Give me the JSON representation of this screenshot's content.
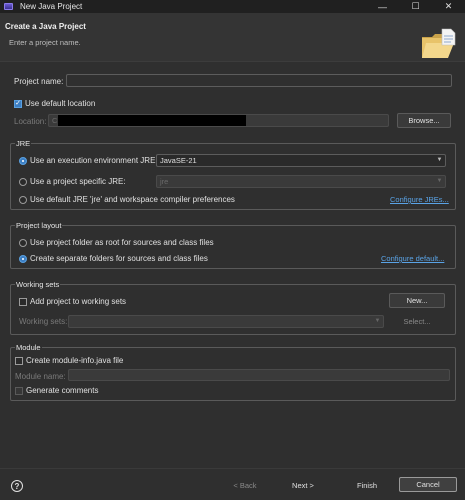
{
  "window": {
    "title": "New Java Project",
    "minimize": "—",
    "maximize": "☐",
    "close": "✕"
  },
  "header": {
    "title": "Create a Java Project",
    "subtitle": "Enter a project name."
  },
  "project_name": {
    "label": "Project name:",
    "value": ""
  },
  "location": {
    "use_default_label": "Use default location",
    "use_default_checked": true,
    "label": "Location:",
    "value": "C:",
    "browse_label": "Browse..."
  },
  "jre": {
    "title": "JRE",
    "option1_label": "Use an execution environment JRE:",
    "option1_value": "JavaSE-21",
    "option2_label": "Use a project specific JRE:",
    "option2_value": "jre",
    "option3_label": "Use default JRE 'jre' and workspace compiler preferences",
    "configure_link": "Configure JREs..."
  },
  "project_layout": {
    "title": "Project layout",
    "option1_label": "Use project folder as root for sources and class files",
    "option2_label": "Create separate folders for sources and class files",
    "configure_link": "Configure default..."
  },
  "working_sets": {
    "title": "Working sets",
    "add_label": "Add project to working sets",
    "new_label": "New...",
    "sets_label": "Working sets:",
    "select_label": "Select..."
  },
  "module": {
    "title": "Module",
    "create_label": "Create module-info.java file",
    "name_label": "Module name:",
    "generate_label": "Generate comments"
  },
  "footer": {
    "help": "?",
    "back_label": "< Back",
    "next_label": "Next >",
    "finish_label": "Finish",
    "cancel_label": "Cancel"
  },
  "colors": {
    "accent": "#3c7fc4",
    "link": "#5aa3e6",
    "background": "#2f2f2f"
  }
}
